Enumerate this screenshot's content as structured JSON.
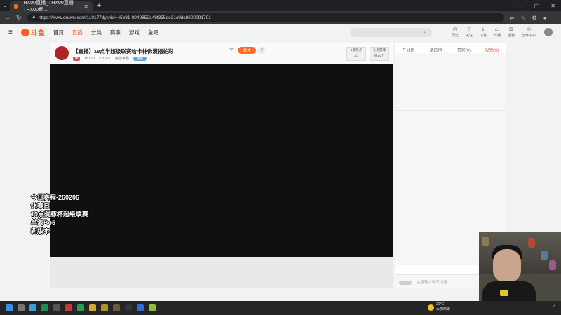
{
  "browser": {
    "tab_label": "THX00直播_THX00直播_THX00翻...",
    "url": "https://www.douyu.com/110177dyshid=45b81-0049852a49f355de31c0dc8600091701"
  },
  "nav": {
    "logo_text": "斗鱼",
    "items": [
      "首页",
      "直播",
      "分类",
      "赛事",
      "游戏",
      "鱼吧"
    ],
    "icons": [
      "历史",
      "关注",
      "下载",
      "开播",
      "福利",
      "创作中心"
    ]
  },
  "room": {
    "title": "【直播】18点半超级联赛哈卡林佛漠福蛇彩",
    "level": "18",
    "streamer": "THX00",
    "viewers": "528777",
    "category": "魔兽争霸",
    "tag": "主播",
    "follow_label": "关注",
    "badge1_line1": "1要热点",
    "badge1_line2": "1/3",
    "badge2_line1": "头条游戏",
    "badge2_line2": "赠10个"
  },
  "overlay_lines": [
    "今日赛程-260206",
    "休赛日",
    "19点洞豚杯超级联赛",
    "单淘Bo5",
    "新版本"
  ],
  "side": {
    "tabs": [
      "在线榜",
      "活跃榜",
      "贵宾(0)",
      "贴贴(0)"
    ],
    "input_placeholder": "这里输入聊天内容"
  },
  "taskbar": {
    "temp": "20°C",
    "weather": "大部晴朗"
  },
  "colors": {
    "accent": "#ff5d23",
    "follow": "#ff6a2c",
    "video_bg": "#101010"
  }
}
